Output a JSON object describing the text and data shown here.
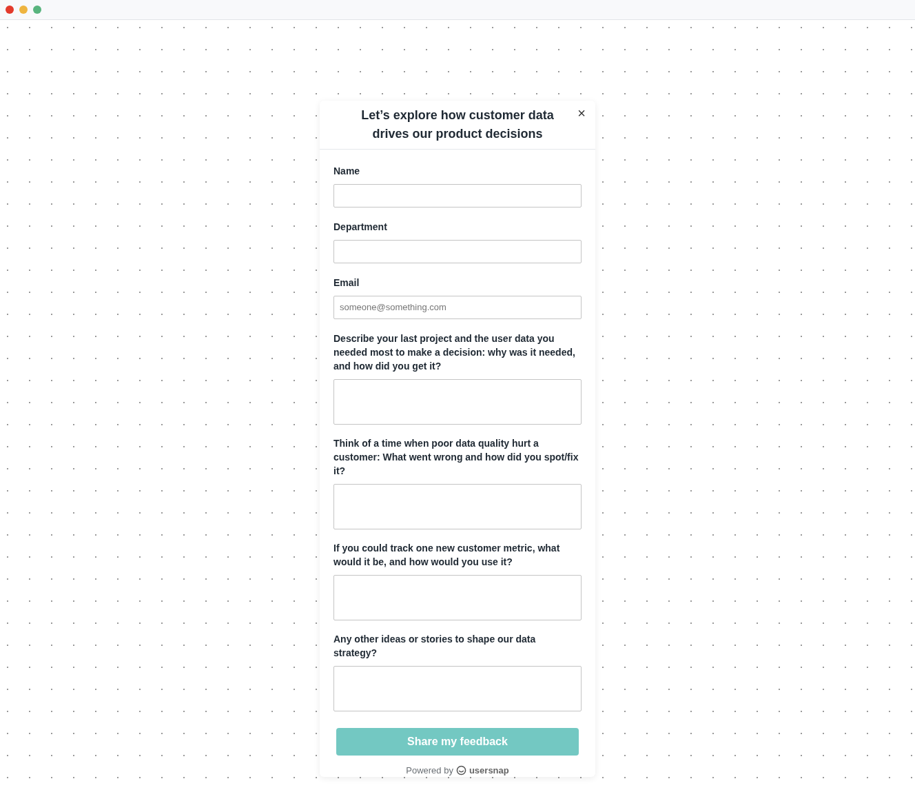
{
  "dialog": {
    "title": "Let’s explore how customer data drives our product decisions",
    "close": "×"
  },
  "fields": [
    {
      "kind": "input",
      "label": "Name"
    },
    {
      "kind": "input",
      "label": "Department"
    },
    {
      "kind": "input",
      "label": "Email",
      "placeholder": "someone@something.com"
    },
    {
      "kind": "textarea",
      "label": "Describe your last project and the user data you needed most to make a decision: why was it needed, and how did you get it?"
    },
    {
      "kind": "textarea",
      "label": "Think of a time when poor data quality hurt a customer: What went wrong and how did you spot/fix it?"
    },
    {
      "kind": "textarea",
      "label": "If you could track one new customer metric, what would it be, and how would you use it?"
    },
    {
      "kind": "textarea",
      "label": "Any other ideas or stories to shape our data strategy?"
    }
  ],
  "submit": "Share my feedback",
  "footer": {
    "powered_by": "Powered by",
    "brand": "usersnap"
  }
}
